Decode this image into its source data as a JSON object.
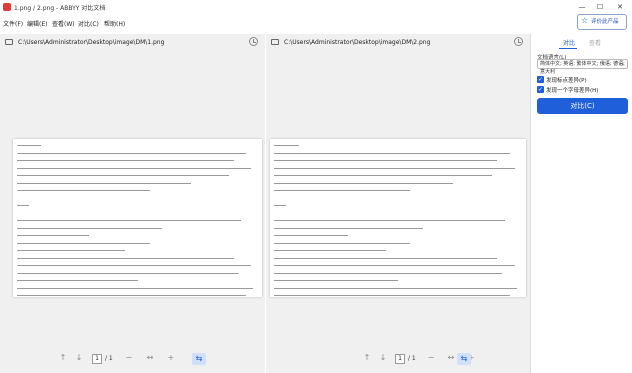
{
  "window": {
    "title": "1.png / 2.png - ABBYY 对比文档",
    "minimize": "—",
    "maximize": "☐",
    "close": "✕"
  },
  "menu": {
    "items": [
      "文件(F)",
      "编辑(E)",
      "查看(W)",
      "对比(C)",
      "帮助(H)"
    ],
    "rate_button": "评价此产品"
  },
  "left_doc": {
    "path": "C:\\Users\\Administrator\\Desktop\\image\\DM\\1.png",
    "page": "1",
    "total": "/ 1"
  },
  "right_doc": {
    "path": "C:\\Users\\Administrator\\Desktop\\image\\DM\\2.png",
    "page": "1",
    "total": "/ 1"
  },
  "panel": {
    "tab_compare": "对比",
    "tab_view": "查看",
    "language_label": "文档语言(L)",
    "language_value": "简体中文; 英语; 繁体中文; 俄语; 德语; 意大利",
    "checkbox1": "发现标点差异(P)",
    "checkbox2": "发现一个字母差异(H)",
    "compare_button": "对比(C)"
  },
  "colors": {
    "accent": "#1f5fd9",
    "panel_bg": "#f0f0f0",
    "logo": "#e53935"
  }
}
